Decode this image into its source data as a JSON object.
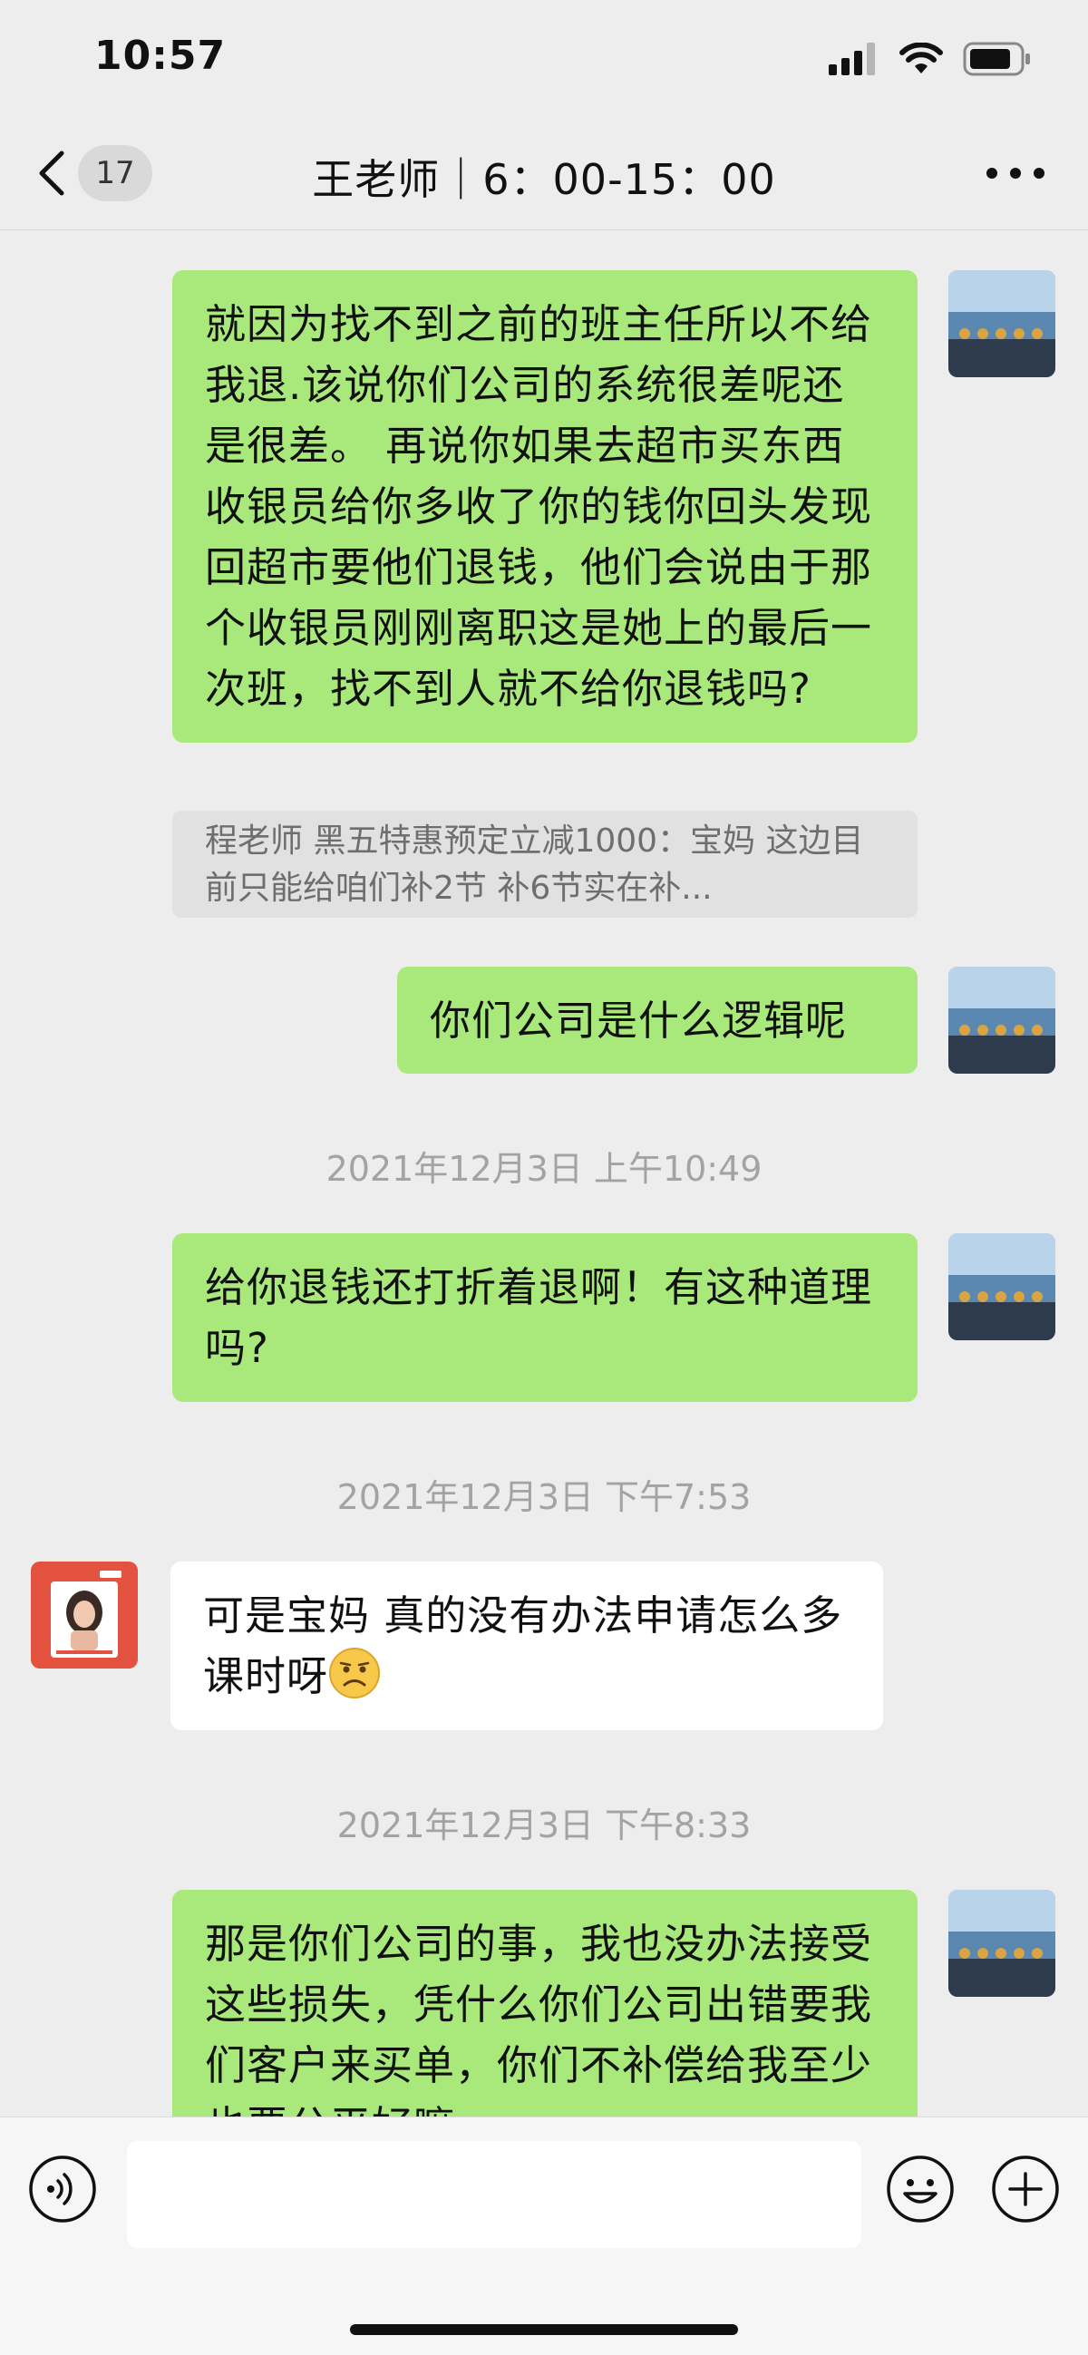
{
  "status_bar": {
    "time": "10:57",
    "icons": [
      "signal-icon",
      "wifi-icon",
      "battery-icon"
    ]
  },
  "nav": {
    "back_count": "17",
    "title": "王老师｜6：00-15：00",
    "icons": [
      "back-arrow-icon",
      "more-icon"
    ]
  },
  "messages": [
    {
      "sender": "me",
      "text": "就因为找不到之前的班主任所以不给我退.该说你们公司的系统很差呢还是很差。 再说你如果去超市买东西收银员给你多收了你的钱你回头发现回超市要他们退钱，他们会说由于那个收银员刚刚离职这是她上的最后一次班，找不到人就不给你退钱吗?"
    },
    {
      "quote": "程老师  黑五特惠预定立减1000：宝妈 这边目前只能给咱们补2节 补6节实在补..."
    },
    {
      "sender": "me",
      "text": "你们公司是什么逻辑呢"
    },
    {
      "timestamp": "2021年12月3日 上午10:49"
    },
    {
      "sender": "me",
      "text": "给你退钱还打折着退啊！有这种道理吗?"
    },
    {
      "timestamp": "2021年12月3日 下午7:53"
    },
    {
      "sender": "other",
      "text": "可是宝妈 真的没有办法申请怎么多课时呀",
      "emoji": "sad-face-emoji"
    },
    {
      "timestamp": "2021年12月3日 下午8:33"
    },
    {
      "sender": "me",
      "text": "那是你们公司的事，我也没办法接受这些损失，凭什么你们公司出错要我们客户来买单，你们不补偿给我至少也要公平好嘛"
    }
  ],
  "input_bar": {
    "icons": [
      "voice-icon",
      "emoji-icon",
      "plus-icon"
    ],
    "placeholder": ""
  },
  "colors": {
    "background": "#ededed",
    "my_bubble": "#a9e97b",
    "other_bubble": "#ffffff",
    "timestamp_text": "#a3a3a3"
  }
}
